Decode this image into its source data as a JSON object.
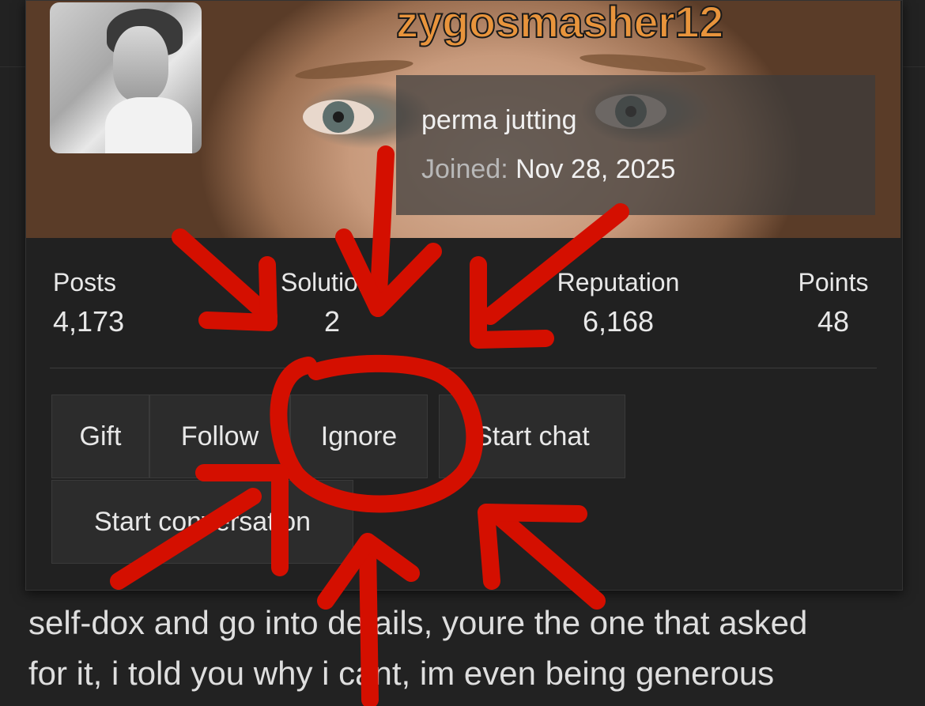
{
  "profile": {
    "username": "zygosmasher12",
    "title": "perma jutting",
    "joined_label": "Joined:",
    "joined_date": "Nov 28, 2025"
  },
  "stats": [
    {
      "label": "Posts",
      "value": "4,173"
    },
    {
      "label": "Solutions",
      "value": "2"
    },
    {
      "label": "Reputation",
      "value": "6,168"
    },
    {
      "label": "Points",
      "value": "48"
    }
  ],
  "actions": {
    "gift": "Gift",
    "follow": "Follow",
    "ignore": "Ignore",
    "start_chat": "Start chat",
    "start_conversation": "Start conversation"
  },
  "post": {
    "line1": "self-dox and go into details, youre the one that asked",
    "line2": "for it, i told you why i cant, im even being generous"
  },
  "colors": {
    "username": "#e8943c",
    "annotation": "#d40f00",
    "background": "#222222"
  }
}
